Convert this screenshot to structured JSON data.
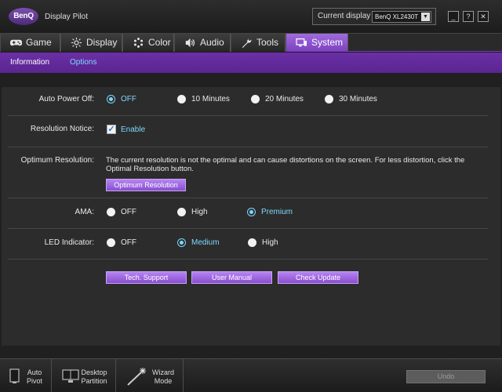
{
  "app": {
    "logo": "BenQ",
    "title": "Display Pilot"
  },
  "current_display": {
    "label": "Current display",
    "value": "BenQ XL2430T"
  },
  "window_buttons": {
    "minimize": "_",
    "help": "?",
    "close": "✕"
  },
  "tabs": [
    {
      "label": "Game",
      "icon": "gamepad-icon"
    },
    {
      "label": "Display",
      "icon": "brightness-icon"
    },
    {
      "label": "Color",
      "icon": "color-dots-icon"
    },
    {
      "label": "Audio",
      "icon": "speaker-icon"
    },
    {
      "label": "Tools",
      "icon": "wrench-icon"
    },
    {
      "label": "System",
      "icon": "monitor-settings-icon",
      "active": true
    }
  ],
  "subtabs": [
    {
      "label": "Information"
    },
    {
      "label": "Options",
      "active": true
    }
  ],
  "options": {
    "auto_power_off": {
      "label": "Auto Power Off:",
      "choices": [
        "OFF",
        "10 Minutes",
        "20 Minutes",
        "30 Minutes"
      ],
      "selected": "OFF"
    },
    "resolution_notice": {
      "label": "Resolution Notice:",
      "checkbox_label": "Enable",
      "checked": true
    },
    "optimum_resolution": {
      "label": "Optimum Resolution:",
      "line1": "The current resolution is not the optimal and can cause distortions on the screen. For less distortion, click the",
      "line2": "Optimal Resolution button.",
      "button": "Optimum Resolution"
    },
    "ama": {
      "label": "AMA:",
      "choices": [
        "OFF",
        "High",
        "Premium"
      ],
      "selected": "Premium"
    },
    "led_indicator": {
      "label": "LED Indicator:",
      "choices": [
        "OFF",
        "Medium",
        "High"
      ],
      "selected": "Medium"
    }
  },
  "action_buttons": {
    "tech_support": "Tech. Support",
    "user_manual": "User Manual",
    "check_update": "Check Update"
  },
  "bottom": {
    "auto_pivot": {
      "line1": "Auto",
      "line2": "Pivot"
    },
    "desktop_partition": {
      "line1": "Desktop",
      "line2": "Partition"
    },
    "wizard_mode": {
      "line1": "Wizard",
      "line2": "Mode"
    },
    "undo": "Undo"
  },
  "colors": {
    "accent_purple": "#7b3fc0",
    "selected_cyan": "#7fd7ff",
    "button_purple": "#a06cdc"
  }
}
